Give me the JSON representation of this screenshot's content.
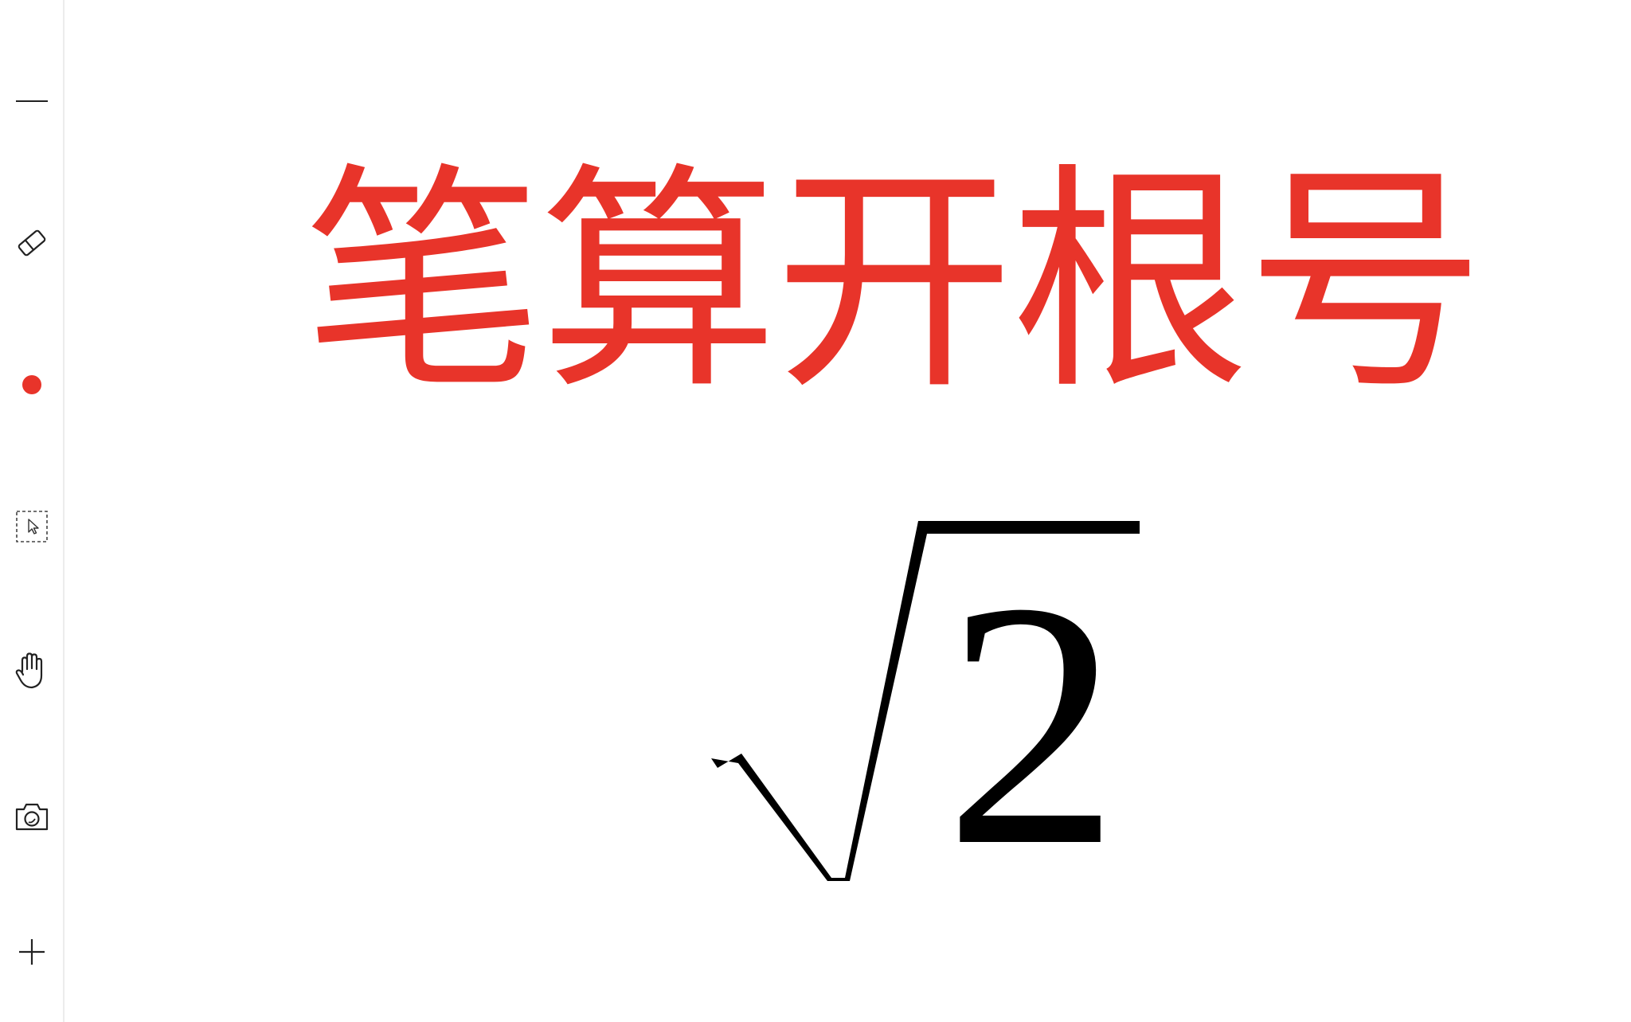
{
  "toolbar": {
    "tools": [
      {
        "name": "line-tool",
        "icon": "minus-line-icon"
      },
      {
        "name": "eraser-tool",
        "icon": "eraser-icon"
      },
      {
        "name": "pen-color",
        "icon": "color-dot-icon",
        "color": "#e8342a"
      },
      {
        "name": "select-tool",
        "icon": "selection-cursor-icon"
      },
      {
        "name": "hand-tool",
        "icon": "hand-icon"
      },
      {
        "name": "screenshot-tool",
        "icon": "camera-icon"
      },
      {
        "name": "add-page",
        "icon": "plus-icon"
      }
    ]
  },
  "canvas": {
    "title": "笔算开根号",
    "title_color": "#e8342a",
    "expression": {
      "symbol": "square-root",
      "radicand": "2",
      "color": "#000000"
    }
  }
}
